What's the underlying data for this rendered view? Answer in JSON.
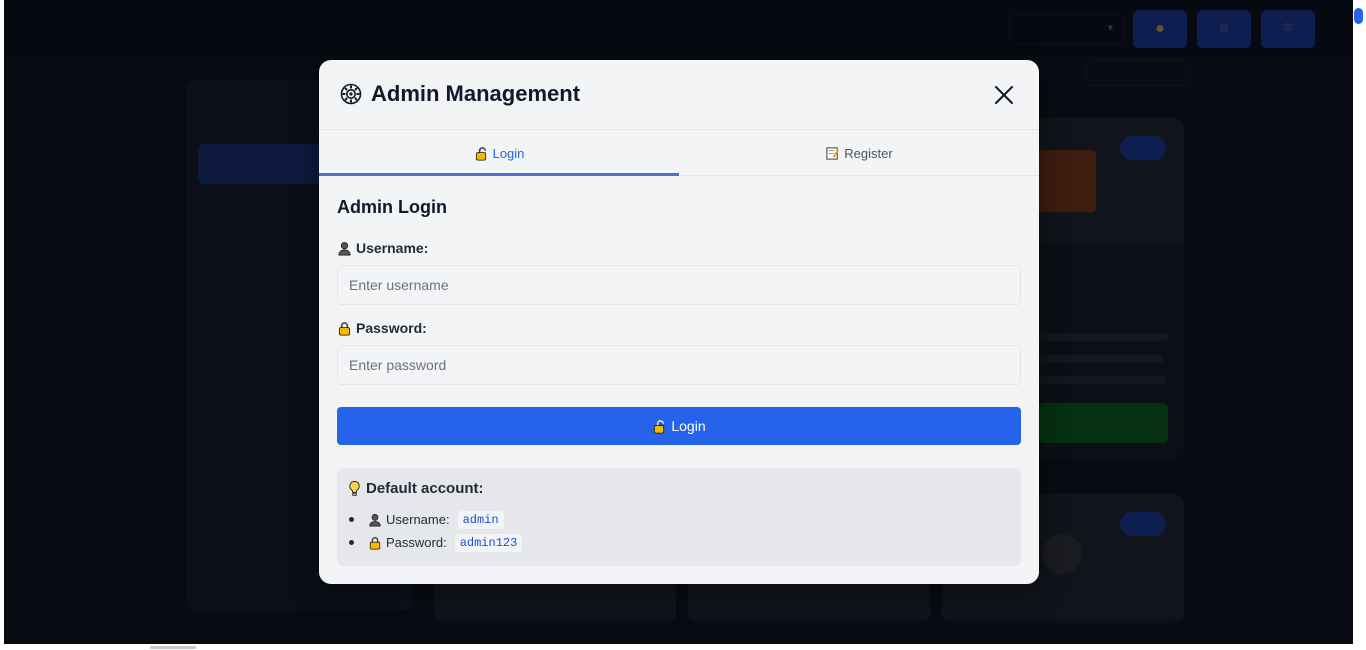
{
  "colors": {
    "primary": "#2563eb",
    "modal_bg": "#f3f4f6",
    "app_bg": "#141a2a"
  },
  "app": {
    "brand": "",
    "nav": [
      "",
      "",
      "",
      ""
    ],
    "language": "",
    "sidebar": {
      "title": "",
      "categories": [
        "",
        "",
        "",
        "",
        "",
        "",
        ""
      ],
      "utilities_title": "",
      "utility_item": ""
    },
    "sort": ""
  },
  "modal": {
    "title": "Admin Management",
    "icon": "gear-icon",
    "close_icon": "close-icon",
    "tabs": [
      {
        "label": "Login",
        "icon": "lock-icon",
        "active": true
      },
      {
        "label": "Register",
        "icon": "memo-icon",
        "active": false
      }
    ],
    "form": {
      "heading": "Admin Login",
      "username_label": "Username:",
      "username_placeholder": "Enter username",
      "username_value": "",
      "password_label": "Password:",
      "password_placeholder": "Enter password",
      "password_value": "",
      "submit_label": "Login"
    },
    "info": {
      "title": "Default account:",
      "icon": "lightbulb-icon",
      "items": [
        {
          "label": "Username:",
          "value": "admin",
          "icon": "user-icon"
        },
        {
          "label": "Password:",
          "value": "admin123",
          "icon": "lock-icon"
        }
      ]
    }
  }
}
